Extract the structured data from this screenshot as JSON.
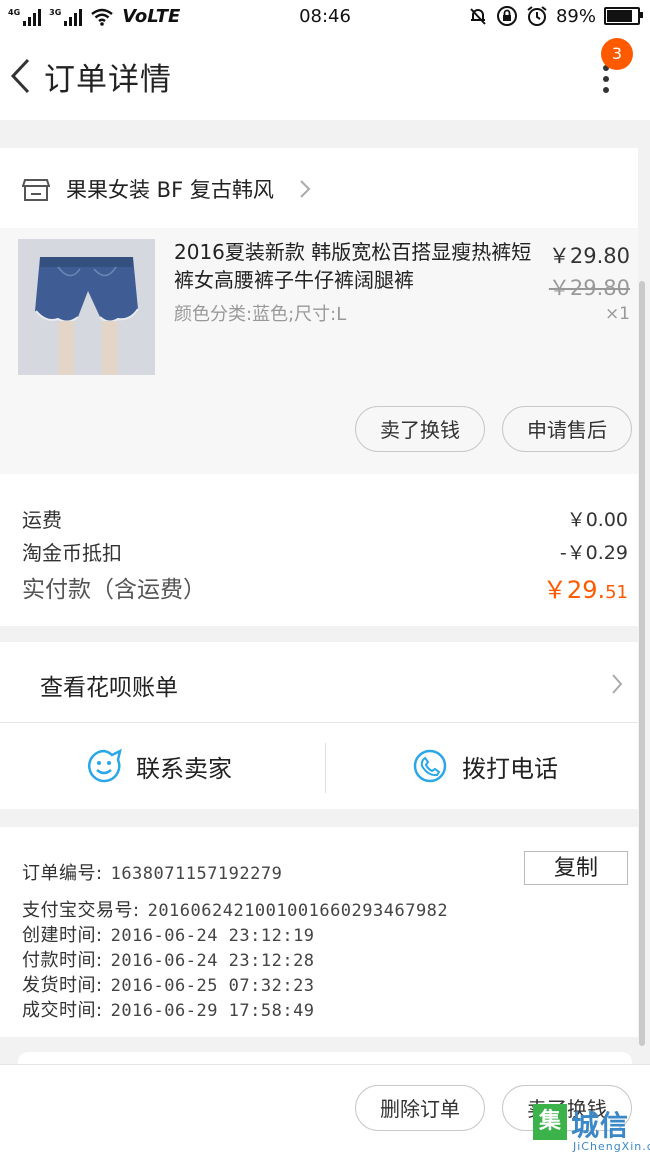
{
  "status_bar": {
    "net1": "4G",
    "net2": "3G",
    "volte": "VoLTE",
    "time": "08:46",
    "battery": "89%",
    "battery_level": 0.89
  },
  "header": {
    "title": "订单详情",
    "badge_count": "3"
  },
  "shop": {
    "name": "果果女装 BF 复古韩风"
  },
  "product": {
    "title": "2016夏装新款 韩版宽松百搭显瘦热裤短裤女高腰裤子牛仔裤阔腿裤",
    "spec": "颜色分类:蓝色;尺寸:L",
    "price": "￥29.80",
    "original_price": "￥29.80",
    "quantity": "×1",
    "sell_button": "卖了换钱",
    "after_sale_button": "申请售后"
  },
  "fees": {
    "shipping_label": "运费",
    "shipping_value": "￥0.00",
    "coin_label": "淘金币抵扣",
    "coin_value": "-￥0.29",
    "total_label": "实付款（含运费）",
    "total_main": "￥29.",
    "total_decimal": "51",
    "accent_color": "#ff5a00"
  },
  "huabei": {
    "label": "查看花呗账单"
  },
  "contact": {
    "seller_label": "联系卖家",
    "phone_label": "拨打电话",
    "icon_color": "#2aa7e8"
  },
  "order_info": {
    "copy_button": "复制",
    "rows": [
      {
        "label": "订单编号:",
        "value": "1638071157192279"
      },
      {
        "label": "支付宝交易号:",
        "value": "2016062421001001660293467982"
      },
      {
        "label": "创建时间:",
        "value": "2016-06-24 23:12:19"
      },
      {
        "label": "付款时间:",
        "value": "2016-06-24 23:12:28"
      },
      {
        "label": "发货时间:",
        "value": "2016-06-25 07:32:23"
      },
      {
        "label": "成交时间:",
        "value": "2016-06-29 17:58:49"
      }
    ]
  },
  "bottom_bar": {
    "delete_button": "删除订单",
    "sell_button": "卖了换钱"
  },
  "watermark": {
    "title": "城信",
    "subtitle": "JiChengXin.com"
  }
}
